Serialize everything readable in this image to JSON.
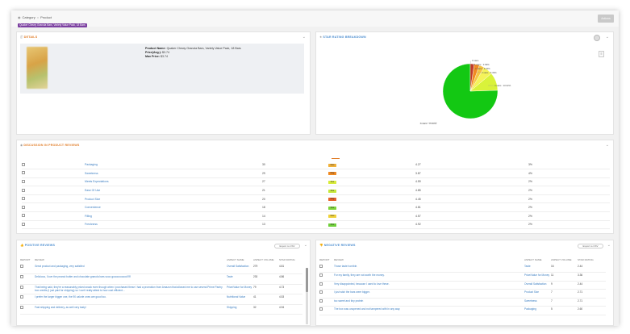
{
  "breadcrumb": {
    "category": "Category",
    "product": "Product"
  },
  "tag": "Quaker Chewy Granola Bars, Variety Value Pack, 18 Bars",
  "actions_label": "Actions",
  "details": {
    "title": "DETAILS",
    "product_name_label": "Product Name",
    "product_name": "Quaker Chewy Granola Bars, Variety Value Pack, 18 Bars",
    "price_avg_label": "Price(Avg.)",
    "price_avg": "$3.74",
    "max_price_label": "Max Price",
    "max_price": "$3.74"
  },
  "star_breakdown": {
    "title": "STAR RATING BREAKDOWN",
    "colors": [
      "#13c813",
      "#d9f23a",
      "#f5f35a",
      "#f6c642",
      "#f08a22",
      "#c0392b"
    ]
  },
  "chart_data": {
    "type": "pie",
    "title": "",
    "slices": [
      {
        "label": "5 stars : 75.50%",
        "value": 75.5
      },
      {
        "label": "4 stars : 10.62%",
        "value": 10.62
      },
      {
        "label": "3 stars : 5.49%",
        "value": 5.49
      },
      {
        "label": "2 stars : 3.02%",
        "value": 3.02
      },
      {
        "label": "1 stars : 3.09%",
        "value": 3.09
      },
      {
        "label": "0 stars",
        "value": 2.28
      }
    ]
  },
  "discussion": {
    "title": "DISCUSSION IN PRODUCT REVIEWS",
    "rows": [
      {
        "aspect": "Packaging",
        "volume": "30",
        "sentiment": "Neu",
        "sent_color": "#f0b13a",
        "rating": "4.27",
        "share": "3%"
      },
      {
        "aspect": "Sweetness",
        "volume": "29",
        "sentiment": "Neg",
        "sent_color": "#f08a22",
        "rating": "3.87",
        "share": "4%"
      },
      {
        "aspect": "Meets Expectations",
        "volume": "27",
        "sentiment": "Pos",
        "sent_color": "#d8ec3a",
        "rating": "4.59",
        "share": "2%"
      },
      {
        "aspect": "Ease Of Use",
        "volume": "21",
        "sentiment": "Pos",
        "sent_color": "#c6e83a",
        "rating": "4.85",
        "share": "2%"
      },
      {
        "aspect": "Product Size",
        "volume": "20",
        "sentiment": "Neg",
        "sent_color": "#e8622a",
        "rating": "4.45",
        "share": "2%"
      },
      {
        "aspect": "Convenience",
        "volume": "18",
        "sentiment": "Pos",
        "sent_color": "#7fd43a",
        "rating": "4.81",
        "share": "2%"
      },
      {
        "aspect": "Filling",
        "volume": "14",
        "sentiment": "Neu",
        "sent_color": "#f0d23a",
        "rating": "4.57",
        "share": "2%"
      },
      {
        "aspect": "Freshness",
        "volume": "13",
        "sentiment": "Pos",
        "sent_color": "#6fcf3a",
        "rating": "4.92",
        "share": "2%"
      }
    ]
  },
  "positive": {
    "title": "POSITIVE REVIEWS",
    "export_label": "Export to CSV",
    "cols": [
      "REPORT",
      "REVIEW",
      "ASPECT NAME",
      "ASPECT VOLUME",
      "STAR RATING"
    ],
    "rows": [
      {
        "review": "Great product and packaging, very satisfied",
        "aspect": "Overall Satisfaction",
        "volume": "279",
        "rating": "4.81"
      },
      {
        "review": "Delicious, I love the peanut butter and chocolate granola bars sooo goooooooood!!!!!",
        "aspect": "Taste",
        "volume": "230",
        "rating": "4.86"
      },
      {
        "review": "That being said, they're a reasonably priced snack even though when I purchased these I had a promotion from Amazon that allowed me to use several Prime Pantry box credits (I just paid for shipping) so I can't really attest to how cost efficient...",
        "aspect": "Price/Value for Money",
        "volume": "79",
        "rating": "4.73"
      },
      {
        "review": "I prefer the larger bigger one, the 90 calorie ones are good too.",
        "aspect": "Nutritional Value",
        "volume": "41",
        "rating": "4.53"
      },
      {
        "review": "Fast shipping and delivery, as well very tasty!",
        "aspect": "Shipping",
        "volume": "32",
        "rating": "4.94"
      }
    ]
  },
  "negative": {
    "title": "NEGATIVE REVIEWS",
    "export_label": "Export to CSV",
    "cols": [
      "REPORT",
      "REVIEW",
      "ASPECT NAME",
      "ASPECT VOLUME",
      "STAR RATING"
    ],
    "rows": [
      {
        "review": "Those taste horrible.",
        "aspect": "Taste",
        "volume": "16",
        "rating": "2.44"
      },
      {
        "review": "For my family, they are not worth the money.",
        "aspect": "Price/Value for Money",
        "volume": "11",
        "rating": "3.36"
      },
      {
        "review": "Very disappointed, because I used to love these.",
        "aspect": "Overall Satisfaction",
        "volume": "9",
        "rating": "2.44"
      },
      {
        "review": "I just wish the bars were bigger.",
        "aspect": "Product Size",
        "volume": "7",
        "rating": "2.71"
      },
      {
        "review": "too sweet and tiny protein",
        "aspect": "Sweetness",
        "volume": "7",
        "rating": "2.71"
      },
      {
        "review": "The box was unopened and not tampered with in any way.",
        "aspect": "Packaging",
        "volume": "5",
        "rating": "2.60"
      }
    ]
  }
}
